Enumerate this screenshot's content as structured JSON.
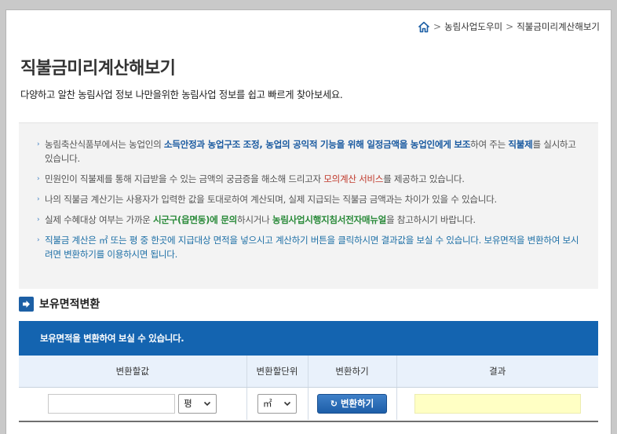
{
  "breadcrumb": {
    "home_icon": "home-icon",
    "items": [
      "농림사업도우미",
      "직불금미리계산해보기"
    ],
    "separator": ">"
  },
  "page": {
    "title": "직불금미리계산해보기",
    "subtitle": "다양하고 알찬 농림사업 정보 나만을위한 농림사업 정보를 쉽고 빠르게 찾아보세요."
  },
  "info": {
    "bullet": "›",
    "items": [
      [
        "농림축산식품부에서는 농업인의 ",
        "소득안정과 농업구조 조정, 농업의 공익적 기능을 위해 일정금액을 농업인에게 보조",
        "하여 주는 ",
        "직불제",
        "를 실시하고 있습니다."
      ],
      [
        "민원인이 직불제를 통해 지급받을 수 있는 금액의 궁금증을 해소해 드리고자 ",
        "모의계산 서비스",
        "를 제공하고 있습니다."
      ],
      [
        "나의 직불금 계산기는 사용자가 입력한 값을 토대로하여 계산되며, 실제 지급되는 직불금 금액과는 차이가 있을 수 있습니다."
      ],
      [
        "실제 수혜대상 여부는 가까운 ",
        "시군구(읍면동)에 문의",
        "하시거나 ",
        "농림사업시행지침서전자매뉴얼",
        "을 참고하시기 바랍니다."
      ],
      [
        "직불금 계산은 ㎡ 또는 평 중 한곳에 지급대상 면적을 넣으시고 계산하기 버튼을 클릭하시면 결과값을 보실 수 있습니다. 보유면적을 변환하여 보시려면 변환하기를 이용하시면 됩니다."
      ]
    ]
  },
  "section": {
    "icon": "arrow-right-icon",
    "title": "보유면적변환",
    "banner": "보유면적을 변환하여 보실 수 있습니다."
  },
  "table": {
    "headers": [
      "변환할값",
      "변환할단위",
      "변환하기",
      "결과"
    ],
    "value_input": {
      "value": "",
      "placeholder": ""
    },
    "from_unit": "평",
    "to_unit": "㎡",
    "convert_button": "변환하기",
    "convert_icon": "refresh-icon",
    "result": ""
  },
  "colors": {
    "accent": "#1464b0",
    "header_bg": "#e9f1fb",
    "result_bg": "#ffffc4",
    "highlight_blue": "#1a5aa0",
    "highlight_red": "#c0392b",
    "highlight_green": "#2a8a3a"
  }
}
